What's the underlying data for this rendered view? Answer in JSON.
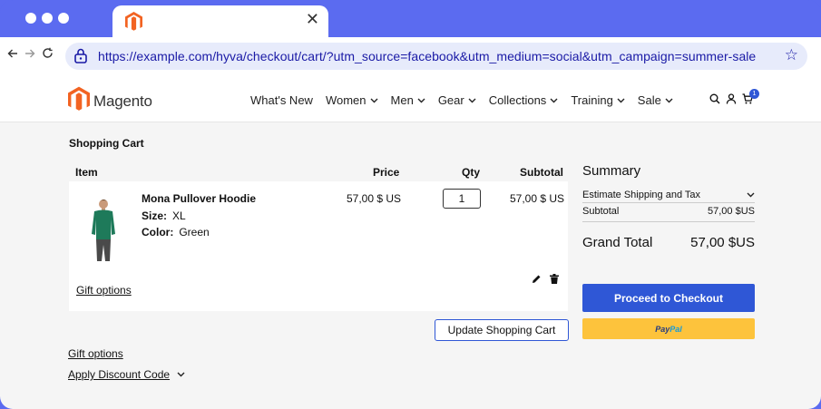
{
  "browser": {
    "url": "https://example.com/hyva/checkout/cart/?utm_source=facebook&utm_medium=social&utm_campaign=summer-sale",
    "tab_close": "✕",
    "back_icon": "arrow-left",
    "forward_icon": "arrow-right",
    "reload_icon": "reload",
    "star_icon": "star-outline"
  },
  "header": {
    "brand": "Magento",
    "nav": [
      {
        "label": "What's New",
        "has_chevron": false
      },
      {
        "label": "Women",
        "has_chevron": true
      },
      {
        "label": "Men",
        "has_chevron": true
      },
      {
        "label": "Gear",
        "has_chevron": true
      },
      {
        "label": "Collections",
        "has_chevron": true
      },
      {
        "label": "Training",
        "has_chevron": true
      },
      {
        "label": "Sale",
        "has_chevron": true
      }
    ],
    "cart_count": "1"
  },
  "cart": {
    "title": "Shopping Cart",
    "columns": {
      "item": "Item",
      "price": "Price",
      "qty": "Qty",
      "subtotal": "Subtotal"
    },
    "items": [
      {
        "name": "Mona Pullover Hoodie",
        "size_label": "Size:",
        "size": "XL",
        "color_label": "Color:",
        "color": "Green",
        "price": "57,00 $ US",
        "qty": "1",
        "subtotal": "57,00 $ US"
      }
    ],
    "gift_options_item": "Gift options",
    "update_button": "Update Shopping Cart",
    "gift_options": "Gift options",
    "apply_discount": "Apply Discount Code"
  },
  "summary": {
    "title": "Summary",
    "estimate": "Estimate Shipping and Tax",
    "subtotal_label": "Subtotal",
    "subtotal_value": "57,00 $US",
    "grand_total_label": "Grand Total",
    "grand_total_value": "57,00 $US",
    "checkout_button": "Proceed to Checkout",
    "paypal_pay": "Pay",
    "paypal_pal": "Pal"
  },
  "colors": {
    "accent": "#2f57d6",
    "frame": "#5b6bf0",
    "paypal": "#fdc33c",
    "brand_orange": "#f26322"
  }
}
